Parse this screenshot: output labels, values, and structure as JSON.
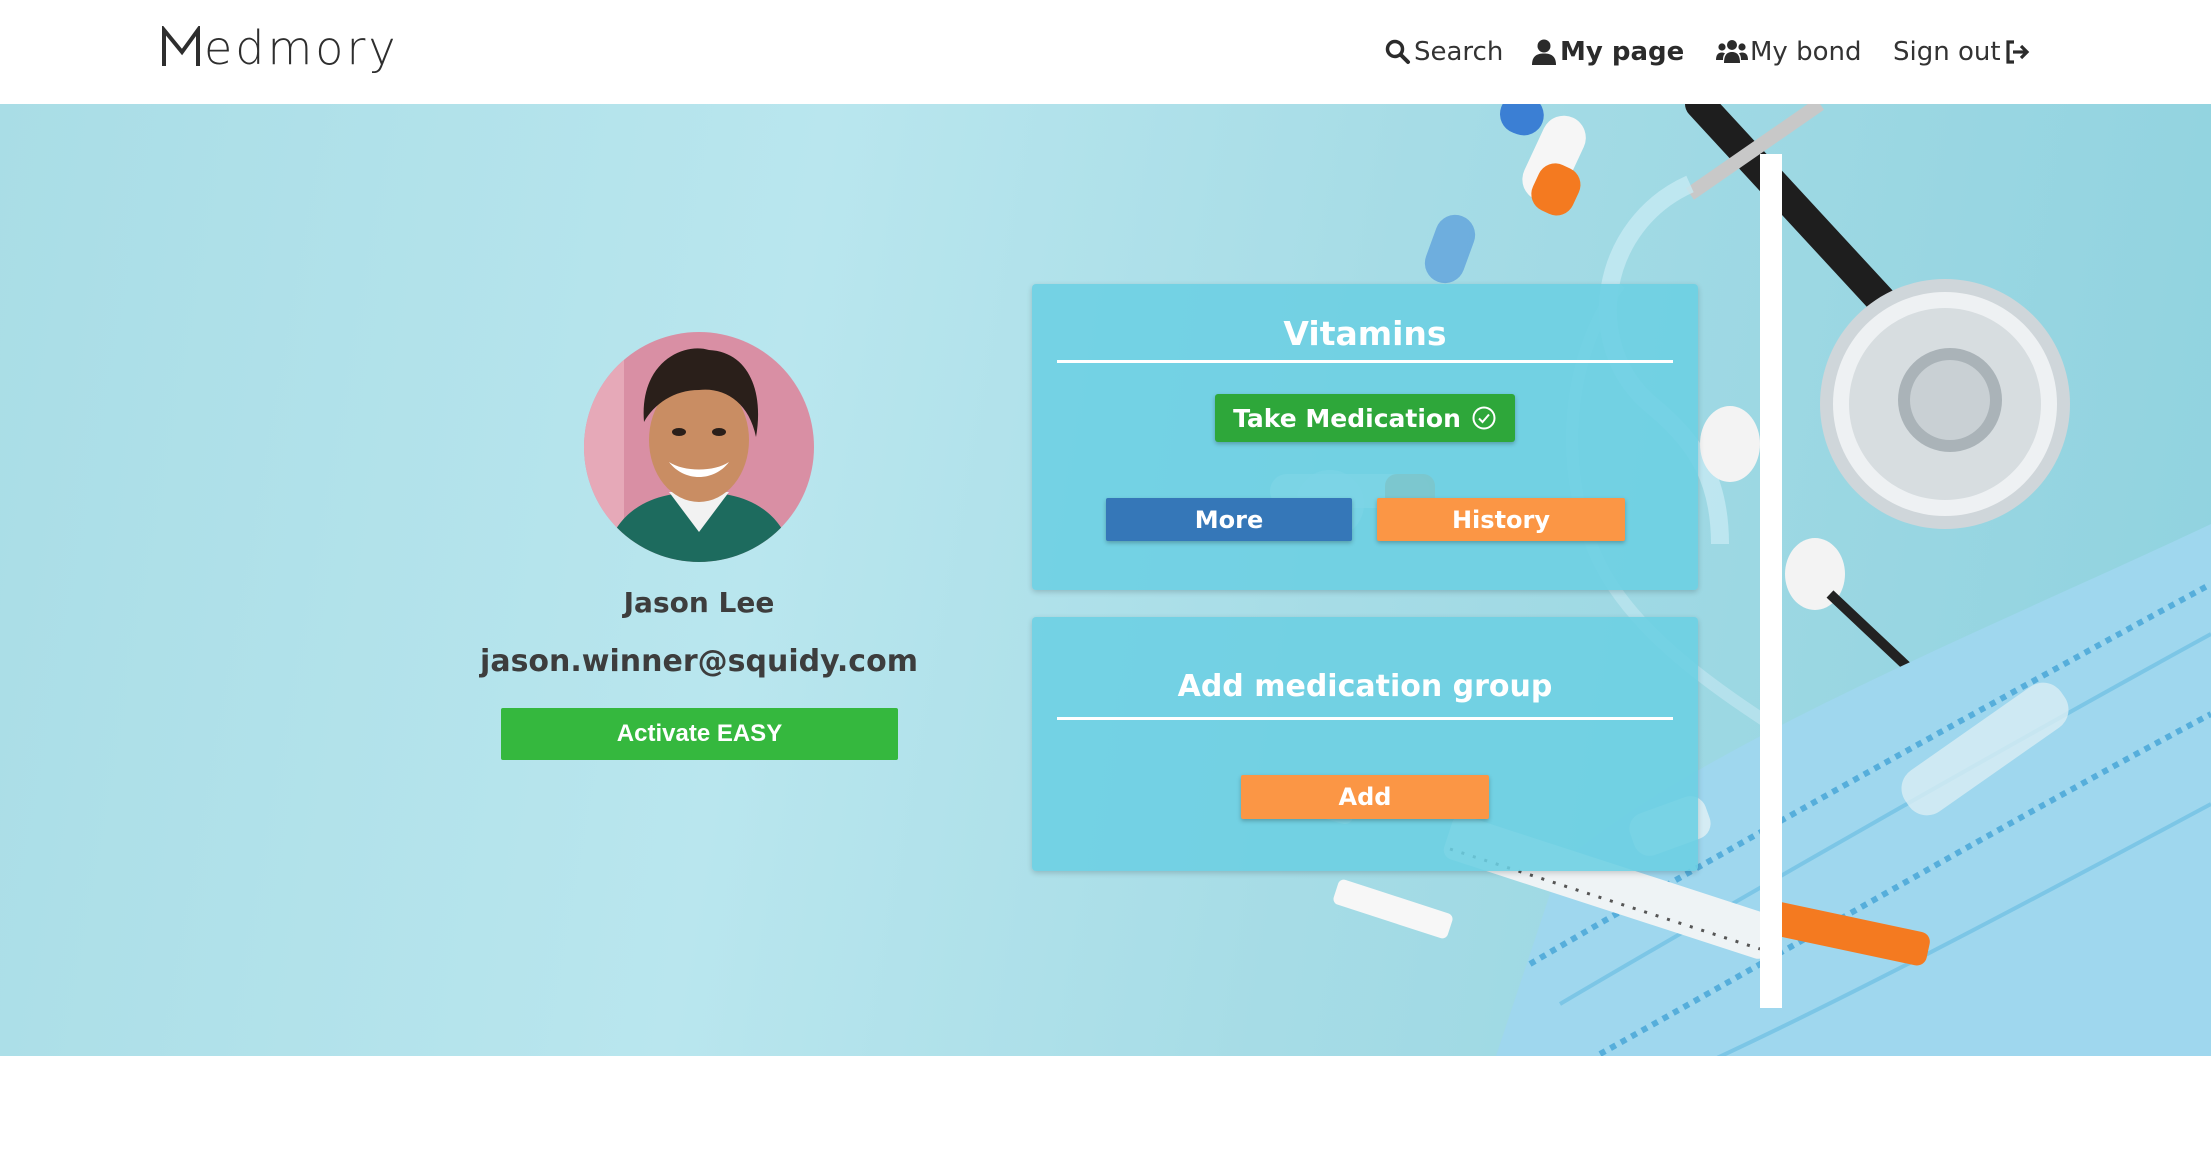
{
  "app": {
    "logo_text": "edmory",
    "logo_icon": "logo-m-mark"
  },
  "nav": {
    "search": {
      "label": "Search",
      "icon": "search-icon"
    },
    "my_page": {
      "label": "My page",
      "icon": "user-icon"
    },
    "my_bond": {
      "label": "My bond",
      "icon": "users-icon"
    },
    "sign_out": {
      "label": "Sign out",
      "icon": "sign-out-icon"
    }
  },
  "profile": {
    "name": "Jason Lee",
    "email": "jason.winner@squidy.com",
    "easy_button": "Activate EASY"
  },
  "medication_group": {
    "title": "Vitamins",
    "take_button": "Take Medication",
    "more_button": "More",
    "history_button": "History"
  },
  "add_group": {
    "title": "Add medication group",
    "add_button": "Add"
  },
  "colors": {
    "accent_green": "#35b83e",
    "take_green": "#2ea73a",
    "more_blue": "#3577b8",
    "orange": "#fb9645",
    "card_bg": "#6bcfe3",
    "hero_bg": "#b9e6ee"
  }
}
